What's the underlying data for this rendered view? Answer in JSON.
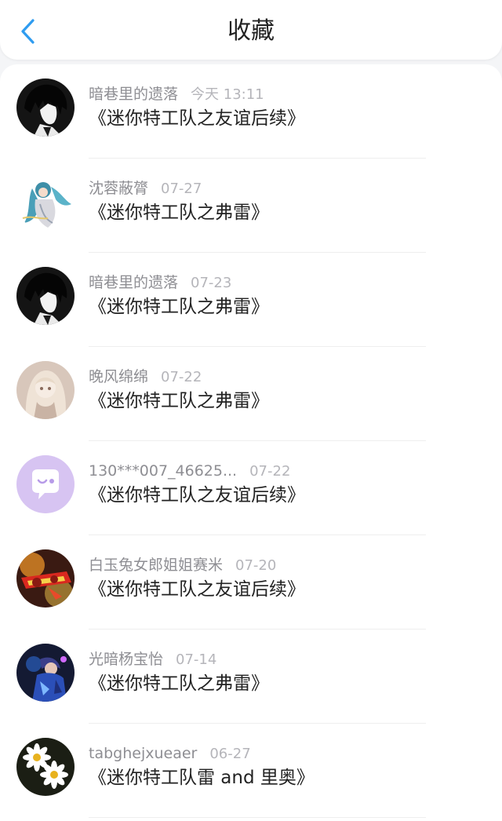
{
  "header": {
    "title": "收藏",
    "back_icon": "chevron-left-icon",
    "accent": "#2f9cf0"
  },
  "items": [
    {
      "name": "暗巷里的遗落",
      "time": "今天 13:11",
      "text": "《迷你特工队之友谊后续》",
      "avatar": "dark-boy"
    },
    {
      "name": "沈蓉蔽膂",
      "time": "07-27",
      "text": "《迷你特工队之弗雷》",
      "avatar": "blue-hair"
    },
    {
      "name": "暗巷里的遗落",
      "time": "07-23",
      "text": "《迷你特工队之弗雷》",
      "avatar": "dark-boy"
    },
    {
      "name": "晚风绵绵",
      "time": "07-22",
      "text": "《迷你特工队之弗雷》",
      "avatar": "beige-girl"
    },
    {
      "name": "130***007_46625...",
      "time": "07-22",
      "text": "《迷你特工队之友谊后续》",
      "avatar": "purple-chat"
    },
    {
      "name": "白玉兔女郎姐姐赛米",
      "time": "07-20",
      "text": "《迷你特工队之友谊后续》",
      "avatar": "red-robot"
    },
    {
      "name": "光暗杨宝怡",
      "time": "07-14",
      "text": "《迷你特工队之弗雷》",
      "avatar": "blue-hero"
    },
    {
      "name": "tabghejxueaer",
      "time": "06-27",
      "text": "《迷你特工队雷 and 里奥》",
      "avatar": "daisies"
    }
  ]
}
